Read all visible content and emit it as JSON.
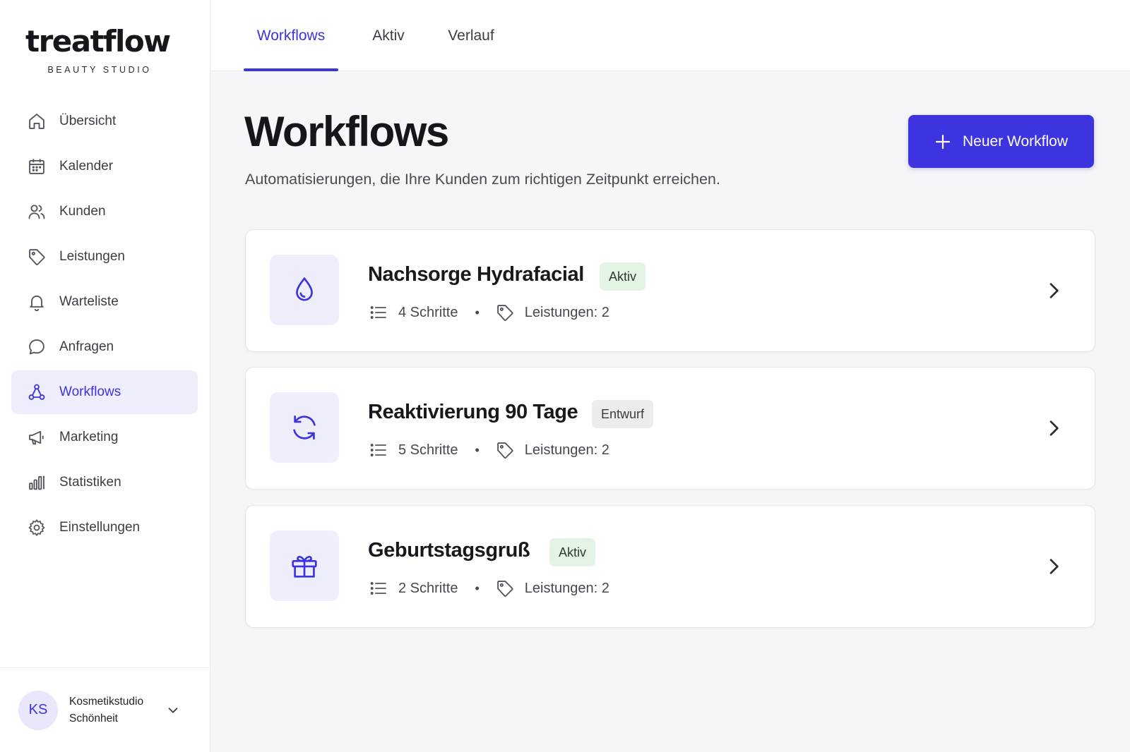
{
  "brand": {
    "name": "treatflow",
    "tagline": "BEAUTY STUDIO"
  },
  "sidebar": {
    "items": [
      {
        "label": "Übersicht",
        "icon": "home-icon",
        "active": false
      },
      {
        "label": "Kalender",
        "icon": "calendar-icon",
        "active": false
      },
      {
        "label": "Kunden",
        "icon": "users-icon",
        "active": false
      },
      {
        "label": "Leistungen",
        "icon": "tag-icon",
        "active": false
      },
      {
        "label": "Warteliste",
        "icon": "bell-icon",
        "active": false
      },
      {
        "label": "Anfragen",
        "icon": "chat-bubble-icon",
        "active": false
      },
      {
        "label": "Workflows",
        "icon": "workflow-icon",
        "active": true
      },
      {
        "label": "Marketing",
        "icon": "megaphone-icon",
        "active": false
      },
      {
        "label": "Statistiken",
        "icon": "bar-chart-icon",
        "active": false
      },
      {
        "label": "Einstellungen",
        "icon": "gear-icon",
        "active": false
      }
    ]
  },
  "account": {
    "initials": "KS",
    "name": "Kosmetikstudio Schönheit"
  },
  "tabs": [
    {
      "label": "Workflows",
      "active": true
    },
    {
      "label": "Aktiv",
      "active": false
    },
    {
      "label": "Verlauf",
      "active": false
    }
  ],
  "header": {
    "title": "Workflows",
    "subtitle": "Automatisierungen, die Ihre Kunden zum richtigen Zeitpunkt erreichen.",
    "new_button": "Neuer Workflow"
  },
  "workflows": [
    {
      "title": "Nachsorge Hydrafacial",
      "status": "Aktiv",
      "steps": "4 Schritte",
      "services": "Leistungen: 2",
      "icon": "droplet-icon"
    },
    {
      "title": "Reaktivierung 90 Tage",
      "status": "Entwurf",
      "steps": "5 Schritte",
      "services": "Leistungen: 2",
      "icon": "refresh-icon"
    },
    {
      "title": "Geburtstagsgruß",
      "status": "Aktiv",
      "steps": "2 Schritte",
      "services": "Leistungen: 2",
      "icon": "gift-icon"
    }
  ],
  "meta_separator": "•",
  "colors": {
    "accent": "#3d34e0",
    "active_nav_bg": "#eeeefd",
    "badge_active_bg": "#e3f4e5",
    "badge_draft_bg": "#ececef",
    "background": "#f6f6f8"
  }
}
